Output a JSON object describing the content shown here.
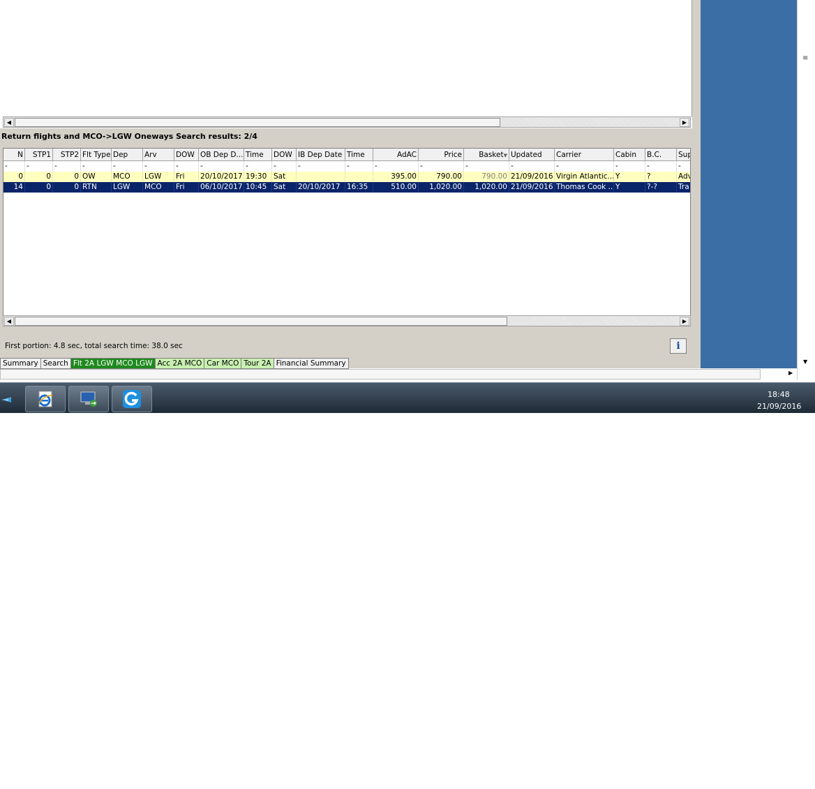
{
  "results_title": "Return flights and MCO->LGW Oneways Search results: 2/4",
  "columns": [
    "N",
    "STP1",
    "STP2",
    "Flt Type",
    "Dep",
    "Arv",
    "DOW",
    "OB Dep D...",
    "Time",
    "DOW",
    "IB Dep Date",
    "Time",
    "AdAC",
    "Price",
    "Basket",
    "Updated",
    "Carrier",
    "Cabin",
    "B.C.",
    "Sup"
  ],
  "filter_row": [
    "-",
    "-",
    "-",
    "-",
    "-",
    "-",
    "-",
    "-",
    "-",
    "-",
    "-",
    "-",
    "-",
    "-",
    "-",
    "-",
    "-",
    "-",
    "-",
    "-"
  ],
  "rows": [
    {
      "selected": false,
      "cells": [
        "0",
        "0",
        "0",
        "OW",
        "MCO",
        "LGW",
        "Fri",
        "20/10/2017",
        "19:30",
        "Sat",
        "",
        "",
        "395.00",
        "790.00",
        "790.00",
        "21/09/2016",
        "Virgin Atlantic...",
        "Y",
        "?",
        "Adv"
      ]
    },
    {
      "selected": true,
      "cells": [
        "14",
        "0",
        "0",
        "RTN",
        "LGW",
        "MCO",
        "Fri",
        "06/10/2017",
        "10:45",
        "Sat",
        "20/10/2017",
        "16:35",
        "510.00",
        "1,020.00",
        "1,020.00",
        "21/09/2016",
        "Thomas Cook ...",
        "Y",
        "?-?",
        "Tra"
      ]
    }
  ],
  "status": {
    "text": "First portion: 4.8 sec, total search time: 38.0 sec",
    "info_label": "i"
  },
  "tabs": [
    {
      "label": "Summary",
      "style": "normal"
    },
    {
      "label": "Search",
      "style": "normal"
    },
    {
      "label": "Flt 2A LGW MCO LGW",
      "style": "green-dark"
    },
    {
      "label": "Acc 2A MCO",
      "style": "green-light"
    },
    {
      "label": "Car MCO",
      "style": "green-light"
    },
    {
      "label": "Tour 2A",
      "style": "green-light"
    },
    {
      "label": "Financial Summary",
      "style": "normal"
    }
  ],
  "taskbar": {
    "apps": [
      "internet-explorer",
      "remote-desktop",
      "google-chrome-like"
    ],
    "clock_time": "18:48",
    "clock_date": "21/09/2016"
  },
  "colors": {
    "selected_row": "#0a246a",
    "yellow_row": "#ffffc0",
    "tab_active": "#1e8a1e",
    "tab_light": "#c8f0b0",
    "desktop_blue": "#3a6ea5"
  }
}
